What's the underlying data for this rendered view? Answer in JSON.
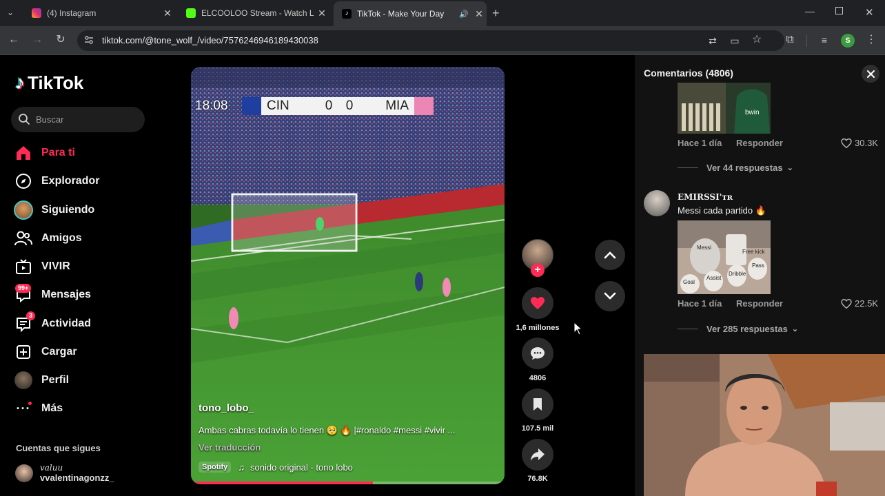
{
  "browser": {
    "tabs": [
      {
        "title": "(4) Instagram",
        "active": false
      },
      {
        "title": "ELCOOLOO Stream - Watch Live",
        "active": false
      },
      {
        "title": "TikTok - Make Your Day",
        "active": true
      }
    ],
    "url": "tiktok.com/@tone_wolf_/video/7576246946189430038",
    "profile_initial": "S"
  },
  "sidebar": {
    "brand": "TikTok",
    "search_placeholder": "Buscar",
    "nav": [
      {
        "label": "Para ti",
        "icon": "home-icon",
        "active": true
      },
      {
        "label": "Explorador",
        "icon": "compass-icon"
      },
      {
        "label": "Siguiendo",
        "icon": "following-avatar-icon"
      },
      {
        "label": "Amigos",
        "icon": "friends-icon"
      },
      {
        "label": "VIVIR",
        "icon": "live-tv-icon"
      },
      {
        "label": "Mensajes",
        "icon": "messages-icon",
        "badge": "99+"
      },
      {
        "label": "Actividad",
        "icon": "activity-icon",
        "badge": "3"
      },
      {
        "label": "Cargar",
        "icon": "upload-icon"
      },
      {
        "label": "Perfil",
        "icon": "profile-avatar-icon"
      },
      {
        "label": "Más",
        "icon": "more-icon"
      }
    ],
    "following_title": "Cuentas que sigues",
    "following_user_display": "valuu",
    "following_user": "vvalentinagonzz_"
  },
  "video": {
    "scoreboard": {
      "clock": "18:08",
      "home": "CIN",
      "home_score": "0",
      "away_score": "0",
      "away": "MIA"
    },
    "author": "tono_lobo_",
    "caption": "Ambas cabras todavía lo tienen 🥺 🔥 |#ronaldo #messi #vivir ...",
    "translate": "Ver traducción",
    "music_tag": "Spotify",
    "sound": "sonido original - tono lobo",
    "progress": 0.58
  },
  "actions": {
    "likes": "1,6 millones",
    "comments": "4806",
    "saves": "107.5 mil",
    "shares": "76.8K"
  },
  "comments": {
    "title": "Comentarios (4806)",
    "items": [
      {
        "time": "Hace 1 día",
        "reply_label": "Responder",
        "likes": "30.3K",
        "view_replies": "Ver 44 respuestas"
      },
      {
        "user": "EMIRSSI'ᴛʀ",
        "text": "Messi cada partido 🔥",
        "sticker_labels": [
          "Messi",
          "Free kick",
          "Pass",
          "Dribble",
          "Assist",
          "Goal"
        ],
        "time": "Hace 1 día",
        "reply_label": "Responder",
        "likes": "22.5K",
        "view_replies": "Ver 285 respuestas"
      }
    ]
  },
  "colors": {
    "accent": "#fe2c55",
    "panel": "#121212",
    "chrome": "#202124"
  }
}
